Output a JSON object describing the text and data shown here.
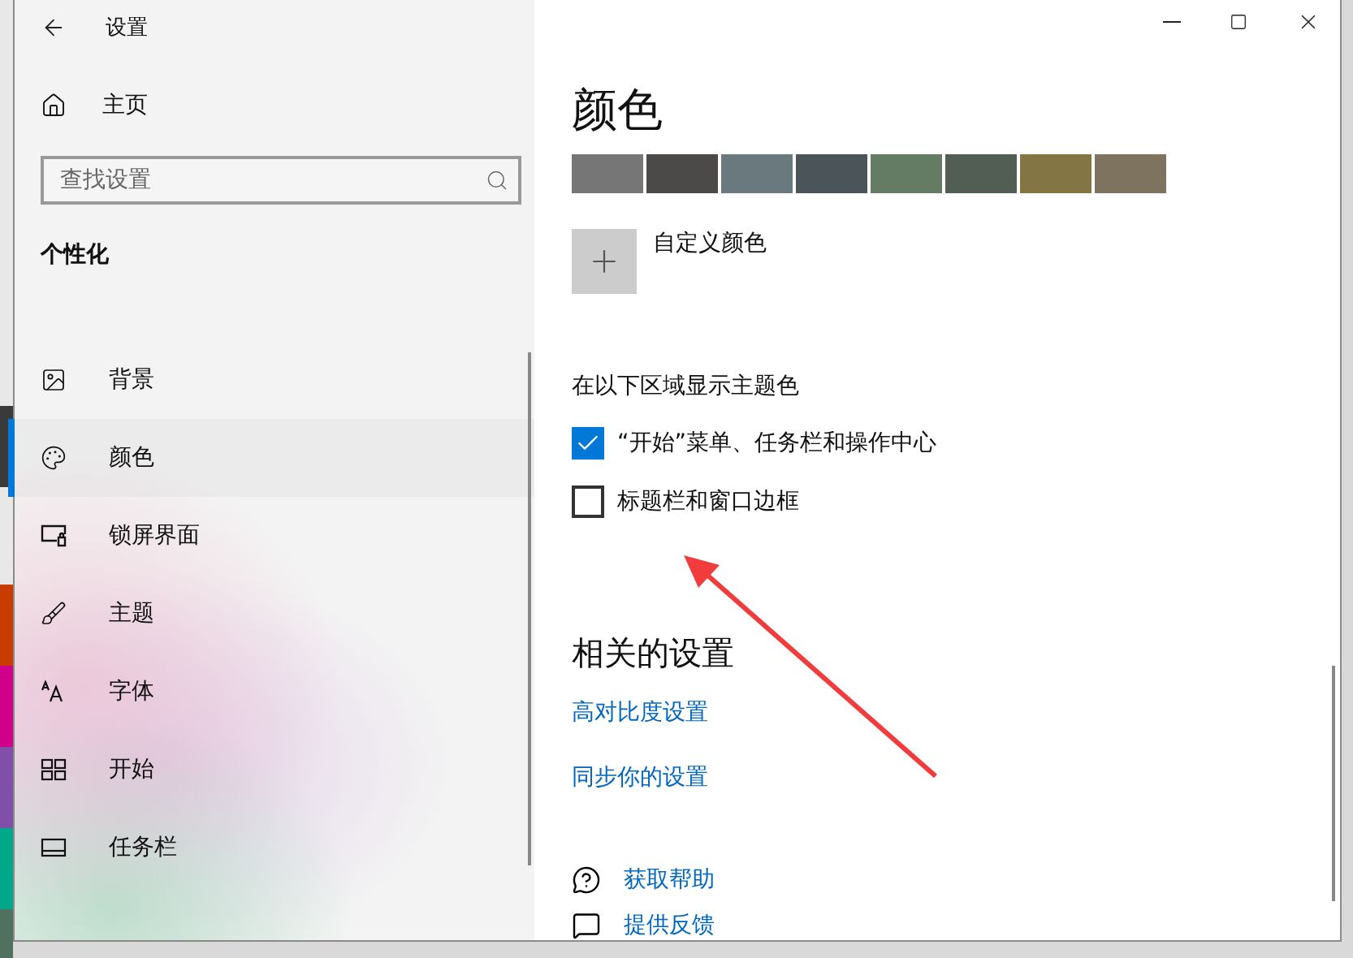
{
  "window": {
    "title": "设置"
  },
  "sidebar": {
    "home": "主页",
    "search": {
      "placeholder": "查找设置"
    },
    "section": "个性化",
    "items": [
      {
        "label": "背景",
        "kind": "background",
        "selected": false
      },
      {
        "label": "颜色",
        "kind": "colors",
        "selected": true
      },
      {
        "label": "锁屏界面",
        "kind": "lockscreen",
        "selected": false
      },
      {
        "label": "主题",
        "kind": "themes",
        "selected": false
      },
      {
        "label": "字体",
        "kind": "fonts",
        "selected": false
      },
      {
        "label": "开始",
        "kind": "start",
        "selected": false
      },
      {
        "label": "任务栏",
        "kind": "taskbar",
        "selected": false
      }
    ]
  },
  "main": {
    "heading": "颜色",
    "swatches": [
      {
        "color": "#767676"
      },
      {
        "color": "#4c4a48"
      },
      {
        "color": "#69797e"
      },
      {
        "color": "#4a5459"
      },
      {
        "color": "#647c64"
      },
      {
        "color": "#525e54"
      },
      {
        "color": "#847545"
      },
      {
        "color": "#7e735f"
      }
    ],
    "custom_color": "自定义颜色",
    "accent": {
      "title": "在以下区域显示主题色",
      "options": [
        {
          "label": "“开始”菜单、任务栏和操作中心",
          "checked": true
        },
        {
          "label": "标题栏和窗口边框",
          "checked": false
        }
      ]
    },
    "related": {
      "title": "相关的设置",
      "links": [
        "高对比度设置",
        "同步你的设置"
      ]
    },
    "support": [
      {
        "label": "获取帮助",
        "kind": "help"
      },
      {
        "label": "提供反馈",
        "kind": "feedback"
      }
    ]
  }
}
